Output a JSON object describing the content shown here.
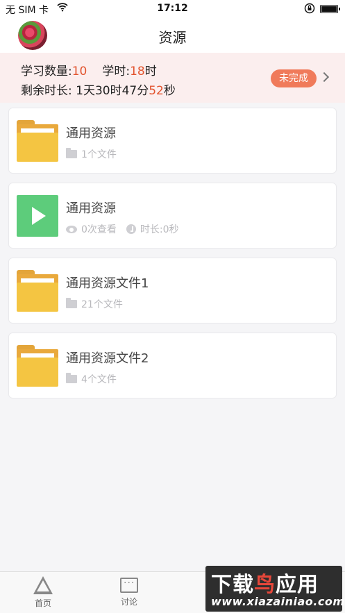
{
  "status_bar": {
    "carrier": "无 SIM 卡",
    "time": "17:12"
  },
  "header": {
    "title": "资源"
  },
  "summary": {
    "count_label": "学习数量:",
    "count_value": "10",
    "hours_label": "学时:",
    "hours_value": "18",
    "hours_unit": "时",
    "remaining_label": "剩余时长: 1天30时47分",
    "remaining_seconds": "52",
    "remaining_unit": "秒",
    "status_badge": "未完成"
  },
  "resources": [
    {
      "type": "folder",
      "name": "通用资源",
      "files": "1个文件"
    },
    {
      "type": "video",
      "name": "通用资源",
      "views": "0次查看",
      "duration": "时长:0秒"
    },
    {
      "type": "folder",
      "name": "通用资源文件1",
      "files": "21个文件"
    },
    {
      "type": "folder",
      "name": "通用资源文件2",
      "files": "4个文件"
    }
  ],
  "tabbar": {
    "items": [
      {
        "label": "首页",
        "icon": "home-icon"
      },
      {
        "label": "讨论",
        "icon": "discussion-icon"
      }
    ]
  },
  "watermark": {
    "main": "下载",
    "accent": "鸟",
    "main_end": "应用",
    "domain": "www.xiazainiao.com"
  },
  "colors": {
    "accent_red": "#e2532d",
    "badge": "#f07a5a",
    "summary_bg": "#fbeeee",
    "folder": "#f4c542",
    "video": "#5dcc7b"
  }
}
